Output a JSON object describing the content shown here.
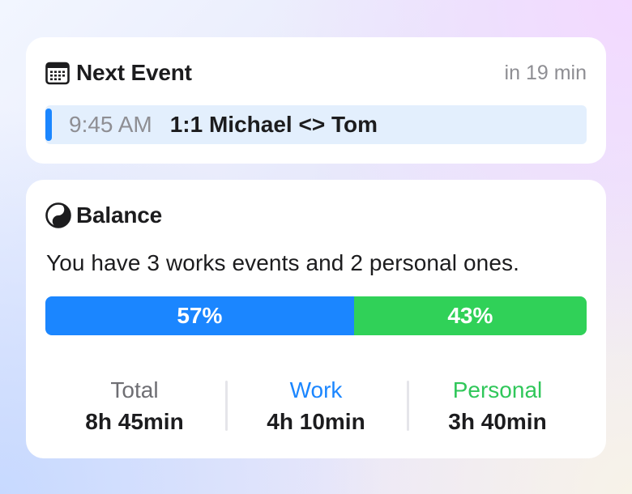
{
  "next_event": {
    "title": "Next Event",
    "icon": "calendar-icon",
    "countdown": "in 19 min",
    "event": {
      "time": "9:45 AM",
      "name": "1:1 Michael <> Tom",
      "accent_color": "#1b86ff"
    }
  },
  "balance": {
    "title": "Balance",
    "icon": "yin-yang-icon",
    "summary": "You have 3 works events and 2 personal ones.",
    "progress": {
      "work_percent": 57,
      "work_label": "57%",
      "personal_percent": 43,
      "personal_label": "43%",
      "work_color": "#1b86ff",
      "personal_color": "#30d158"
    },
    "stats": [
      {
        "label": "Total",
        "value": "8h 45min"
      },
      {
        "label": "Work",
        "value": "4h 10min"
      },
      {
        "label": "Personal",
        "value": "3h 40min"
      }
    ]
  }
}
